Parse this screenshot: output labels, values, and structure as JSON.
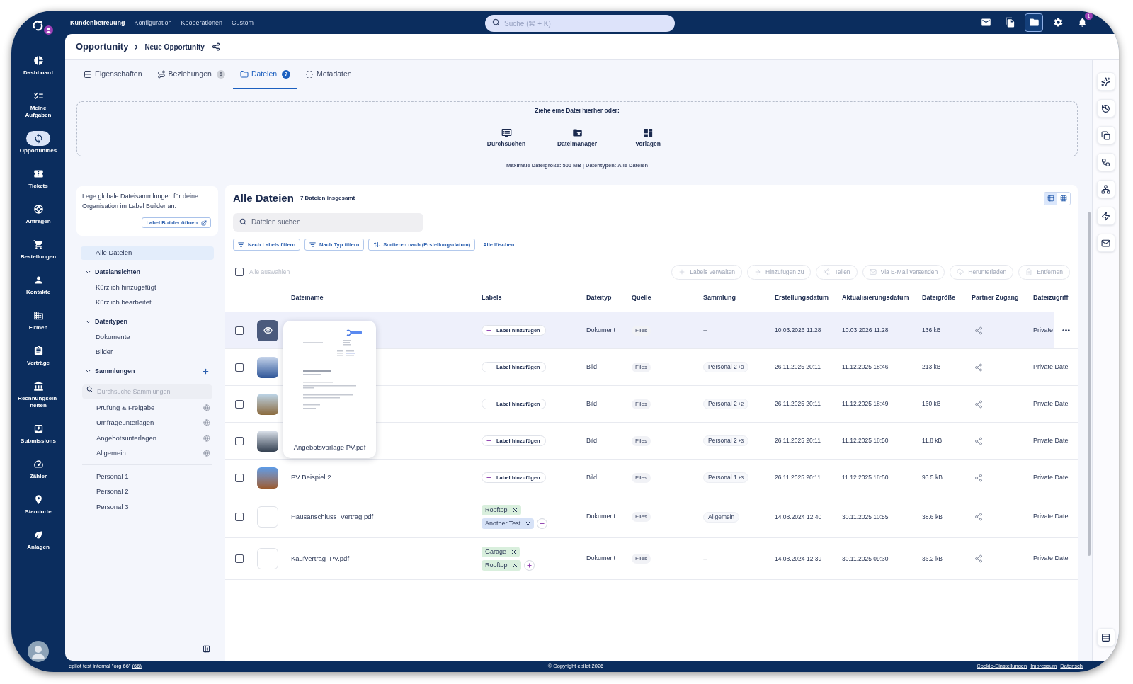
{
  "topbar": {
    "nav": [
      {
        "label": "Kundenbetreuung",
        "selected": true
      },
      {
        "label": "Konfiguration",
        "selected": false
      },
      {
        "label": "Kooperationen",
        "selected": false
      },
      {
        "label": "Custom",
        "selected": false
      }
    ],
    "search": {
      "placeholder": "Suche (⌘ + K)"
    },
    "tools": [
      {
        "selected": false
      },
      {
        "selected": false
      },
      {
        "selected": true
      },
      {
        "selected": false
      },
      {
        "selected": false,
        "badge": "1"
      }
    ]
  },
  "sidebar": {
    "items": [
      {
        "label": "Dashboard",
        "selected": false
      },
      {
        "label": "Meine Aufgaben",
        "selected": false
      },
      {
        "label": "Opportunities",
        "selected": true
      },
      {
        "label": "Tickets",
        "selected": false
      },
      {
        "label": "Anfragen",
        "selected": false
      },
      {
        "label": "Bestellungen",
        "selected": false
      },
      {
        "label": "Kontakte",
        "selected": false
      },
      {
        "label": "Firmen",
        "selected": false
      },
      {
        "label": "Verträge",
        "selected": false
      },
      {
        "label": "Rechnungsein-heiten",
        "selected": false
      },
      {
        "label": "Submissions",
        "selected": false
      },
      {
        "label": "Zähler",
        "selected": false
      },
      {
        "label": "Standorte",
        "selected": false
      },
      {
        "label": "Anlagen",
        "selected": false
      }
    ]
  },
  "breadcrumb": {
    "parent": "Opportunity",
    "current": "Neue Opportunity"
  },
  "tabs": [
    {
      "label": "Eigenschaften",
      "selected": false
    },
    {
      "label": "Beziehungen",
      "badge": "6",
      "selected": false
    },
    {
      "label": "Dateien",
      "badge": "7",
      "selected": true
    },
    {
      "label": "Metadaten",
      "selected": false
    }
  ],
  "upload": {
    "prompt": "Ziehe eine Datei hierher oder:",
    "options": [
      "Durchsuchen",
      "Dateimanager",
      "Vorlagen"
    ],
    "limits": "Maximale Dateigröße: 500 MB | Datentypen: Alle Dateien"
  },
  "library": {
    "info": "Lege globale Dateisammlungen für deine Organisation im Label Builder an.",
    "info_button": "Label Builder öffnen",
    "all_files": {
      "label": "Alle Dateien",
      "selected": true
    },
    "sections": [
      {
        "title": "Dateiansichten",
        "expanded": true,
        "items": [
          {
            "label": "Kürzlich hinzugefügt",
            "selected": false
          },
          {
            "label": "Kürzlich bearbeitet",
            "selected": false
          }
        ]
      },
      {
        "title": "Dateitypen",
        "expanded": true,
        "items": [
          {
            "label": "Dokumente",
            "selected": false
          },
          {
            "label": "Bilder",
            "selected": false
          }
        ]
      }
    ],
    "collections": {
      "title": "Sammlungen",
      "expanded": true,
      "search_placeholder": "Durchsuche Sammlungen",
      "shared": [
        {
          "label": "Prüfung & Freigabe",
          "selected": false,
          "global": true
        },
        {
          "label": "Umfrageunterlagen",
          "selected": false,
          "global": true
        },
        {
          "label": "Angebotsunterlagen",
          "selected": false,
          "global": true
        },
        {
          "label": "Allgemein",
          "selected": false,
          "global": true
        }
      ],
      "personal": [
        {
          "label": "Personal 1",
          "selected": false,
          "global": false
        },
        {
          "label": "Personal 2",
          "selected": false,
          "global": false
        },
        {
          "label": "Personal 3",
          "selected": false,
          "global": false
        }
      ]
    }
  },
  "files": {
    "title": "Alle Dateien",
    "count": "7 Dateien insgesamt",
    "view_toggle": [
      {
        "selected": true
      },
      {
        "selected": false
      }
    ],
    "search": {
      "placeholder": "Dateien suchen"
    },
    "filters": [
      {
        "kind": "filter",
        "label": "Nach Labels filtern"
      },
      {
        "kind": "filter",
        "label": "Nach Typ filtern"
      },
      {
        "kind": "sort",
        "label": "Sortieren nach (Erstellungsdatum)"
      },
      {
        "kind": "link",
        "label": "Alle löschen"
      }
    ],
    "select_all": {
      "label": "Alle auswählen",
      "checked": false,
      "disabled": true
    },
    "bulk_actions": [
      {
        "label": "Labels verwalten",
        "disabled": true
      },
      {
        "label": "Hinzufügen zu",
        "disabled": true
      },
      {
        "label": "Teilen",
        "disabled": true
      },
      {
        "label": "Via E-Mail versenden",
        "disabled": true
      },
      {
        "label": "Herunterladen",
        "disabled": true
      },
      {
        "label": "Entfernen",
        "disabled": true
      }
    ],
    "columns": [
      "Dateiname",
      "Labels",
      "Dateityp",
      "Quelle",
      "Sammlung",
      "Erstellungsdatum",
      "Aktualisierungsdatum",
      "Dateigröße",
      "Partner Zugang",
      "Dateizugriff"
    ],
    "rows": [
      {
        "checked": false,
        "hovered": true,
        "thumbnail": {
          "kind": "hover"
        },
        "add_label": "Label hinzufügen",
        "type": "Dokument",
        "source": "Files",
        "collection": {
          "kind": "none",
          "name": "–"
        },
        "created": "10.03.2026 11:28",
        "updated": "10.03.2026 11:28",
        "size": "136 kB",
        "access": "Private"
      },
      {
        "checked": false,
        "hovered": false,
        "thumbnail": {
          "kind": "photo"
        },
        "add_label": "Label hinzufügen",
        "type": "Bild",
        "source": "Files",
        "collection": {
          "kind": "tag",
          "name": "Personal 2",
          "more": "+3"
        },
        "created": "26.11.2025 20:11",
        "updated": "11.12.2025 18:46",
        "size": "213 kB",
        "access": "Private Datei"
      },
      {
        "checked": false,
        "hovered": false,
        "thumbnail": {
          "kind": "photo"
        },
        "add_label": "Label hinzufügen",
        "type": "Bild",
        "source": "Files",
        "collection": {
          "kind": "tag",
          "name": "Personal 2",
          "more": "+2"
        },
        "created": "26.11.2025 20:11",
        "updated": "11.12.2025 18:49",
        "size": "160 kB",
        "access": "Private Datei"
      },
      {
        "checked": false,
        "hovered": false,
        "thumbnail": {
          "kind": "photo"
        },
        "add_label": "Label hinzufügen",
        "type": "Bild",
        "source": "Files",
        "collection": {
          "kind": "tag",
          "name": "Personal 2",
          "more": "+3"
        },
        "created": "26.11.2025 20:11",
        "updated": "11.12.2025 18:50",
        "size": "11.8 kB",
        "access": "Private Datei"
      },
      {
        "checked": false,
        "hovered": false,
        "thumbnail": {
          "kind": "photo"
        },
        "name": "PV Beispiel 2",
        "add_label": "Label hinzufügen",
        "type": "Bild",
        "source": "Files",
        "collection": {
          "kind": "tag",
          "name": "Personal 1",
          "more": "+3"
        },
        "created": "26.11.2025 20:11",
        "updated": "11.12.2025 18:50",
        "size": "93.5 kB",
        "access": "Private Datei"
      },
      {
        "checked": false,
        "hovered": false,
        "thumbnail": {
          "kind": "blank"
        },
        "name": "Hausanschluss_Vertrag.pdf",
        "labels": [
          {
            "text": "Rooftop",
            "color": "#d9efdd"
          },
          {
            "text": "Another Test",
            "color": "#d6e2f7"
          }
        ],
        "type": "Dokument",
        "source": "Files",
        "collection": {
          "kind": "tag",
          "name": "Allgemein"
        },
        "created": "14.08.2024 12:40",
        "updated": "30.11.2025 10:55",
        "size": "38.6 kB",
        "access": "Private Datei"
      },
      {
        "checked": false,
        "hovered": false,
        "thumbnail": {
          "kind": "blank"
        },
        "name": "Kaufvertrag_PV.pdf",
        "labels": [
          {
            "text": "Garage",
            "color": "#d9efdd"
          },
          {
            "text": "Rooftop",
            "color": "#d9efdd"
          }
        ],
        "type": "Dokument",
        "source": "Files",
        "collection": {
          "kind": "none",
          "name": "–"
        },
        "created": "14.08.2024 12:39",
        "updated": "30.11.2025 09:30",
        "size": "36.2 kB",
        "access": "Private Datei"
      }
    ],
    "preview": {
      "caption": "Angebotsvorlage PV.pdf"
    }
  },
  "footer": {
    "org": "epilot test internal \"org 66\"",
    "org_link": "(66)",
    "copyright": "© Copyright epilot 2026",
    "links": [
      "Cookie-Einstellungen",
      "Impressum",
      "Datensch"
    ]
  }
}
